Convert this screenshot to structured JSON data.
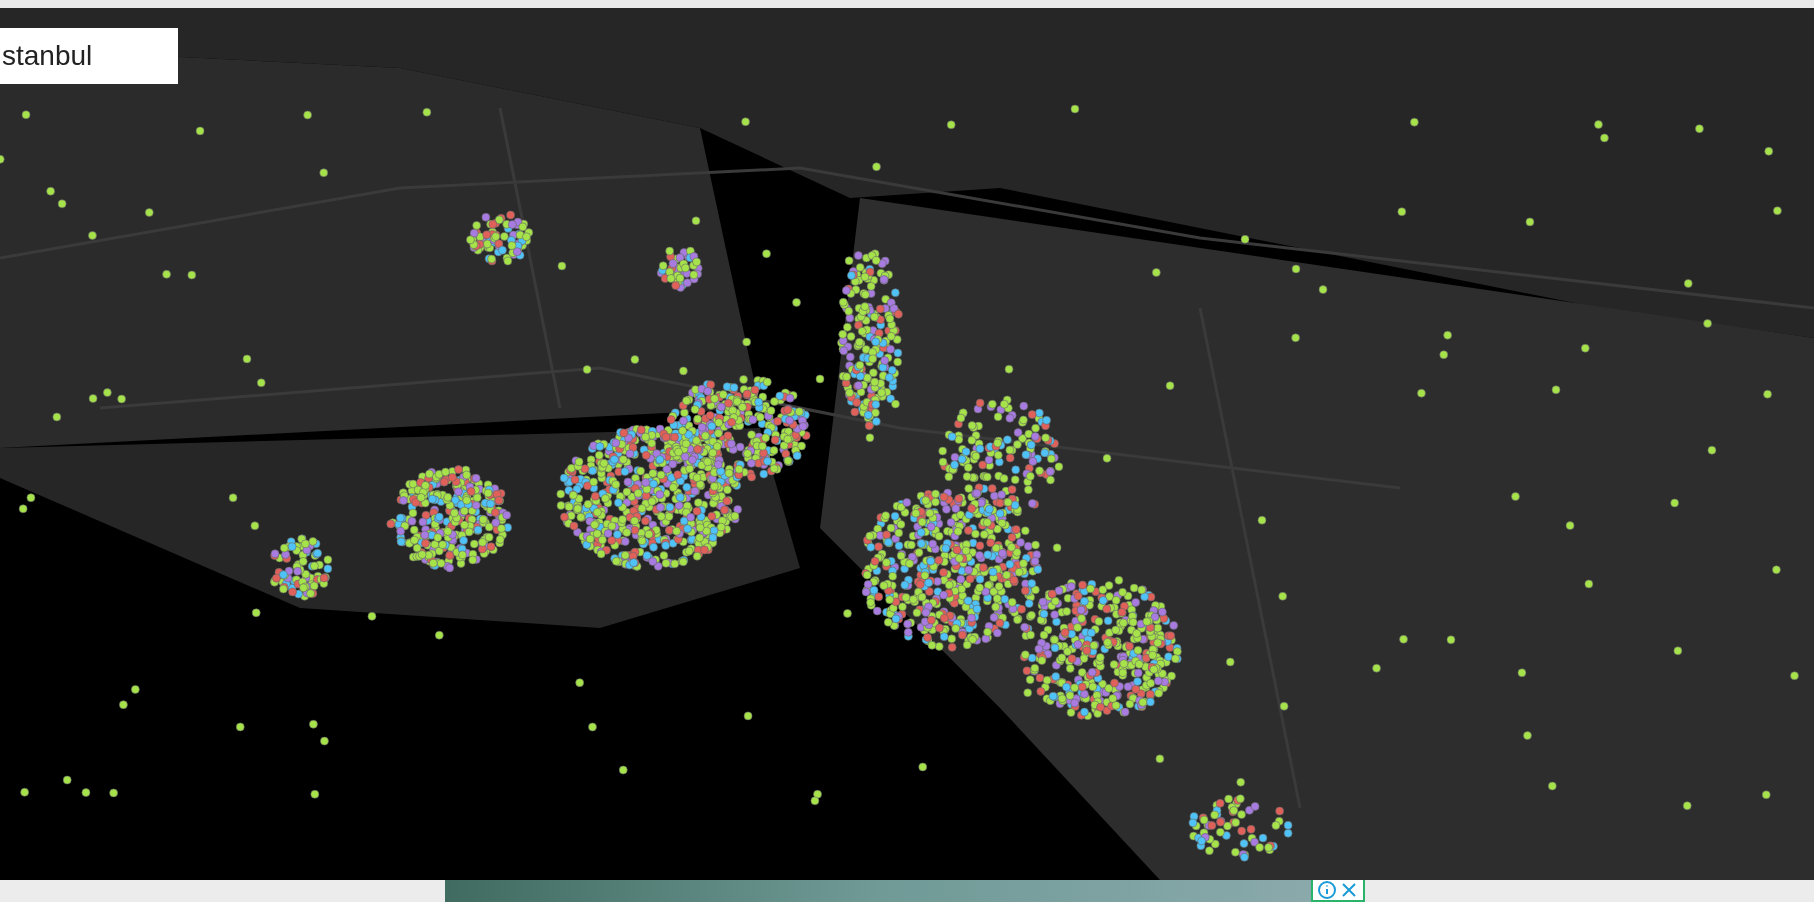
{
  "map": {
    "label": "stanbul"
  }
}
